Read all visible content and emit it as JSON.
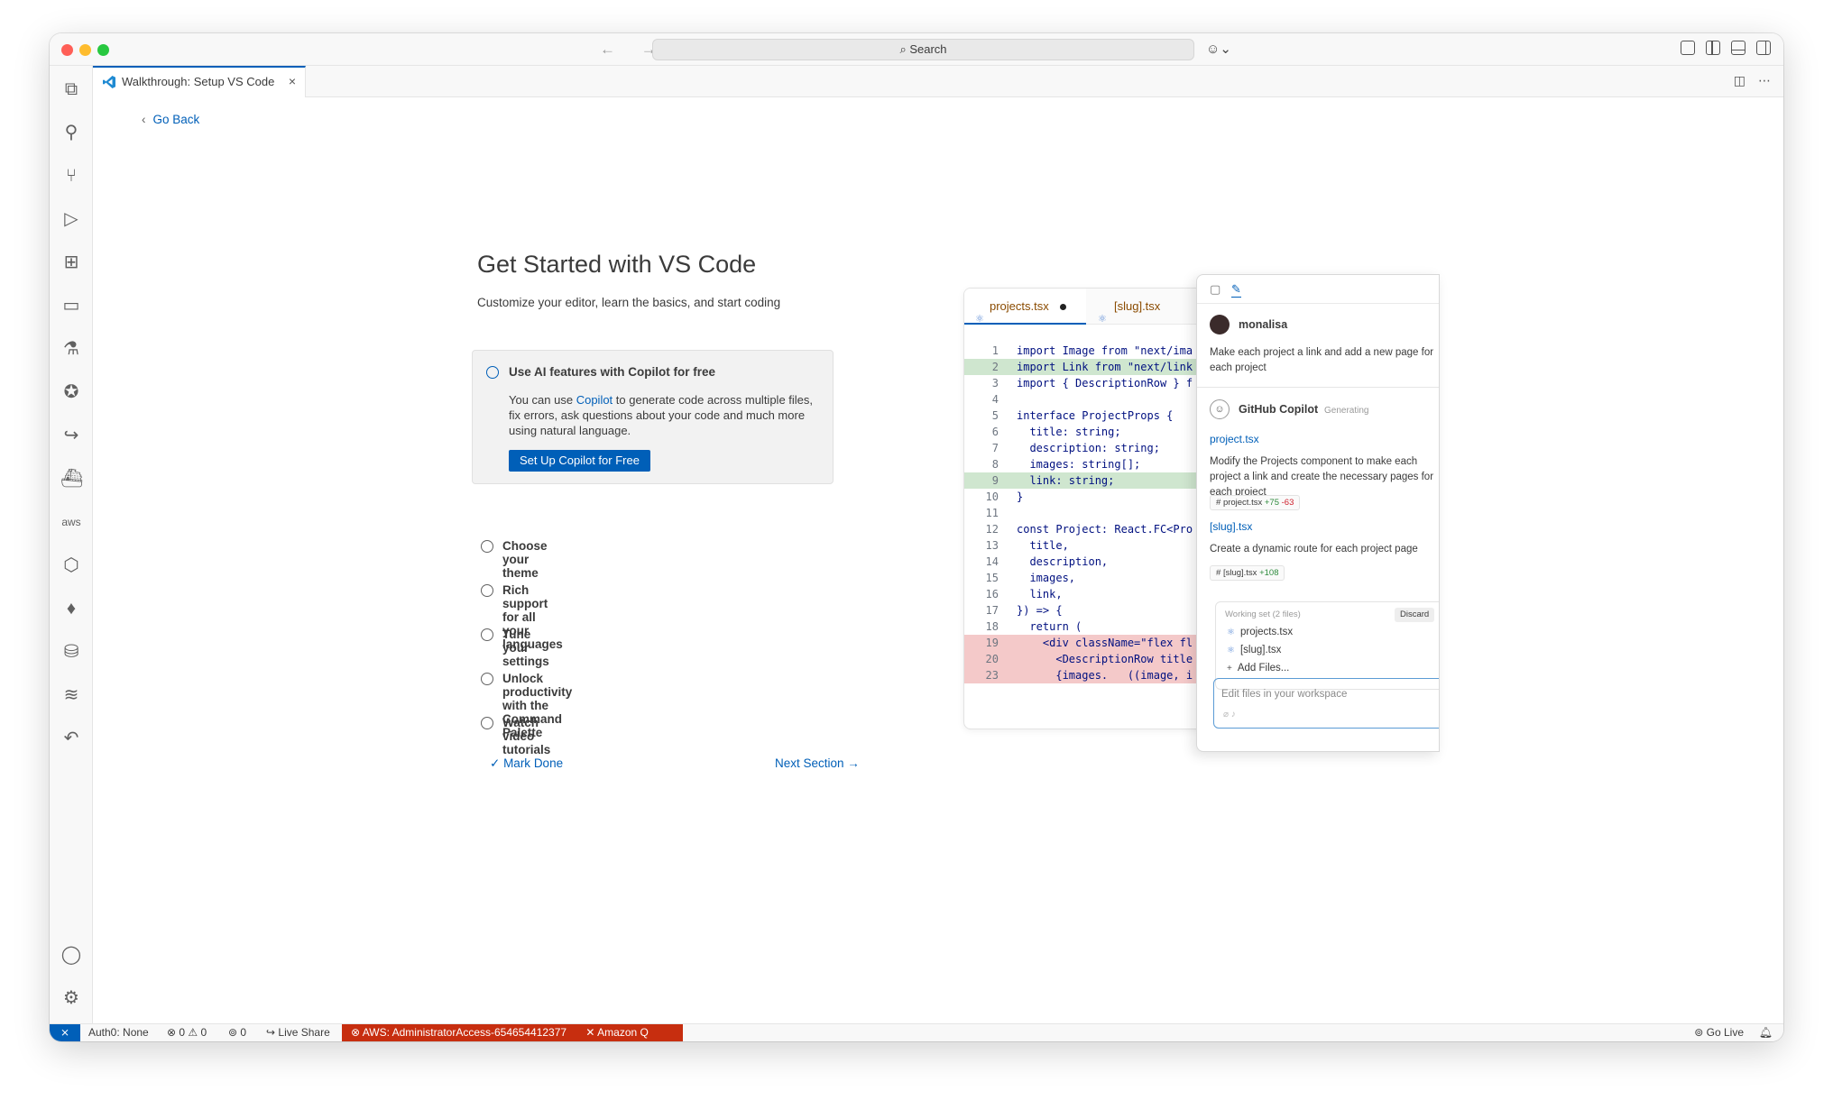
{
  "titlebar": {
    "search_label": "Search",
    "nav_arrows": "← →",
    "copilot_icon": "copilot-icon"
  },
  "tab": {
    "label": "Walkthrough: Setup VS Code",
    "close": "×",
    "actions": [
      "split-editor-icon",
      "more-icon"
    ]
  },
  "nav": {
    "go_back": "Go Back"
  },
  "walkthrough": {
    "title": "Get Started with VS Code",
    "subtitle": "Customize your editor, learn the basics, and start coding",
    "active_step": {
      "title": "Use AI features with Copilot for free",
      "desc_before": "You can use ",
      "desc_link": "Copilot",
      "desc_after": " to generate code across multiple files, fix errors, ask questions about your code and much more using natural language.",
      "button": "Set Up Copilot for Free"
    },
    "steps": [
      "Choose your theme",
      "Rich support for all your languages",
      "Tune your settings",
      "Unlock productivity with the Command Palette",
      "Watch video tutorials"
    ],
    "mark_done": "Mark Done",
    "next_section": "Next Section"
  },
  "illustration": {
    "editor_tabs": [
      "projects.tsx",
      "[slug].tsx"
    ],
    "code_lines": [
      {
        "n": "1",
        "text": "import Image from \"next/ima"
      },
      {
        "n": "2",
        "text": "import Link from \"next/link"
      },
      {
        "n": "3",
        "text": "import { DescriptionRow } f"
      },
      {
        "n": "4",
        "text": ""
      },
      {
        "n": "5",
        "text": "interface ProjectProps {"
      },
      {
        "n": "6",
        "text": "  title: string;"
      },
      {
        "n": "7",
        "text": "  description: string;"
      },
      {
        "n": "8",
        "text": "  images: string[];"
      },
      {
        "n": "9",
        "text": "  link: string;"
      },
      {
        "n": "10",
        "text": "}"
      },
      {
        "n": "11",
        "text": ""
      },
      {
        "n": "12",
        "text": "const Project: React.FC<Pro"
      },
      {
        "n": "13",
        "text": "  title,"
      },
      {
        "n": "14",
        "text": "  description,"
      },
      {
        "n": "15",
        "text": "  images,"
      },
      {
        "n": "16",
        "text": "  link,"
      },
      {
        "n": "17",
        "text": "}) => {"
      },
      {
        "n": "18",
        "text": "  return ("
      },
      {
        "n": "19",
        "text": "    <div className=\"flex fl"
      },
      {
        "n": "20",
        "text": "      <DescriptionRow title"
      },
      {
        "n": "23",
        "text": "      {images.   ((image, i"
      }
    ],
    "chat": {
      "user": "monalisa",
      "user_msg": "Make each project a link and add a new page for each project",
      "assistant": "GitHub Copilot",
      "status": "Generating",
      "file1": "project.tsx",
      "text1": "Modify the Projects component to make each project a link and create the necessary pages for each project",
      "chip1_name": "project.tsx",
      "chip1_plus": "+75",
      "chip1_minus": "-63",
      "file2": "[slug].tsx",
      "text2": "Create a dynamic route for each project page",
      "chip2_name": "[slug].tsx",
      "chip2_plus": "+108",
      "working_set": "Working set (2 files)",
      "discard": "Discard",
      "ws_files": [
        "projects.tsx",
        "[slug].tsx"
      ],
      "add_files": "Add Files...",
      "input_placeholder": "Edit files in your workspace"
    }
  },
  "statusbar": {
    "remote": "⨯",
    "auth": "Auth0: None",
    "problems": "⊗ 0 ⚠ 0",
    "ports": "0",
    "live_share": "Live Share",
    "aws": "AWS: AdministratorAccess-654654412377",
    "amazon_q": "Amazon Q",
    "go_live": "Go Live"
  },
  "colors": {
    "accent": "#005fb8",
    "aws_bar": "#c72e0f"
  }
}
